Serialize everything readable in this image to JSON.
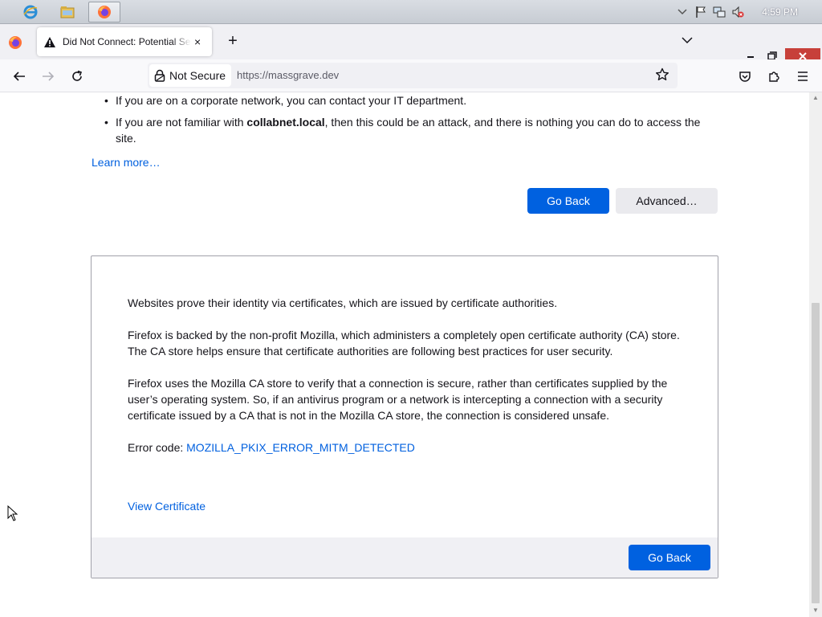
{
  "taskbar": {
    "apps": [
      "Internet Explorer",
      "File Explorer",
      "Firefox"
    ],
    "clock": "4:59 PM"
  },
  "browser": {
    "tab_title": "Did Not Connect: Potential Security Issue",
    "tab_close": "×",
    "new_tab": "+",
    "identity_label": "Not Secure",
    "url": "https://massgrave.dev"
  },
  "page": {
    "bullets": [
      {
        "text": "If you are on a corporate network, you can contact your IT department."
      },
      {
        "pre": "If you are not familiar with ",
        "bold": "collabnet.local",
        "post": ", then this could be an attack, and there is nothing you can do to access the site."
      }
    ],
    "learn_more": "Learn more…",
    "go_back": "Go Back",
    "advanced": "Advanced…"
  },
  "advanced_panel": {
    "paragraphs": [
      "Websites prove their identity via certificates, which are issued by certificate authorities.",
      "Firefox is backed by the non-profit Mozilla, which administers a completely open certificate authority (CA) store. The CA store helps ensure that certificate authorities are following best practices for user security.",
      "Firefox uses the Mozilla CA store to verify that a connection is secure, rather than certificates supplied by the user’s operating system. So, if an antivirus program or a network is intercepting a connection with a security certificate issued by a CA that is not in the Mozilla CA store, the connection is considered unsafe."
    ],
    "error_code_label": "Error code: ",
    "error_code": "MOZILLA_PKIX_ERROR_MITM_DETECTED",
    "view_certificate": "View Certificate",
    "go_back": "Go Back"
  },
  "colors": {
    "primary_button": "#0061e0",
    "link": "#0060df",
    "close_button": "#c7403a"
  }
}
